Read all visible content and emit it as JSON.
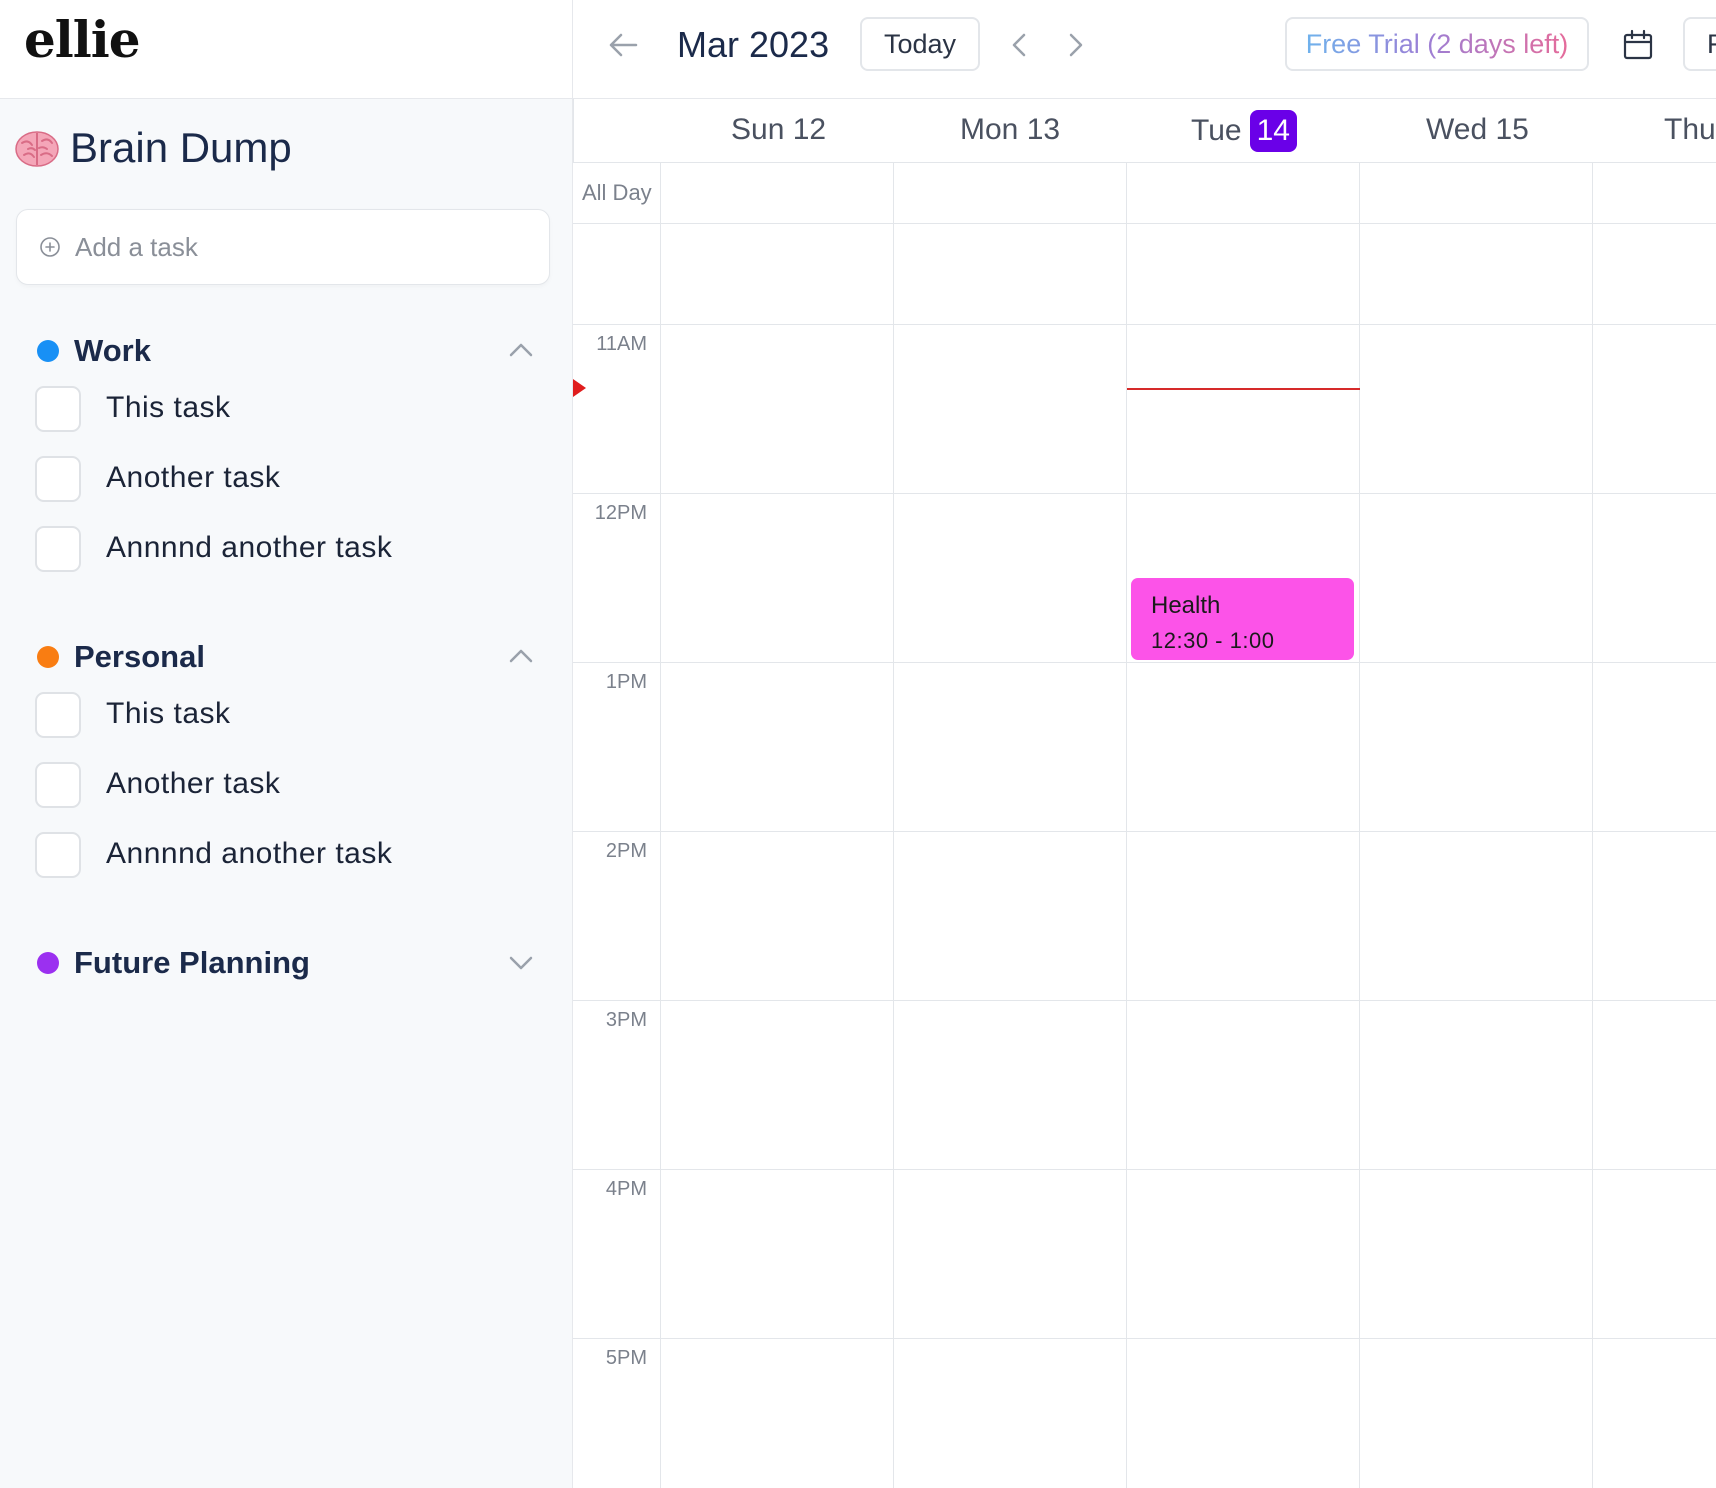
{
  "app": {
    "logo": "ellie"
  },
  "sidebar": {
    "title": "Brain Dump",
    "title_icon": "brain-icon",
    "add_task": {
      "placeholder": "Add a task",
      "icon": "plus-circle-icon"
    },
    "groups": [
      {
        "name": "Work",
        "color": "#1890f5",
        "expanded": true,
        "chevron": "chevron-up-icon",
        "tasks": [
          "This task",
          "Another task",
          "Annnnd another task"
        ]
      },
      {
        "name": "Personal",
        "color": "#f97d12",
        "expanded": true,
        "chevron": "chevron-up-icon",
        "tasks": [
          "This task",
          "Another task",
          "Annnnd another task"
        ]
      },
      {
        "name": "Future Planning",
        "color": "#9b30f0",
        "expanded": false,
        "chevron": "chevron-down-icon",
        "tasks": []
      }
    ]
  },
  "header": {
    "back_icon": "arrow-left-icon",
    "month": "Mar 2023",
    "today_label": "Today",
    "prev_icon": "chevron-left-icon",
    "next_icon": "chevron-right-icon",
    "trial_label": "Free Trial (2 days left)",
    "calendar_icon": "calendar-icon",
    "cut_button_label": "F"
  },
  "calendar": {
    "days": [
      {
        "name": "Sun",
        "date": "12",
        "today": false
      },
      {
        "name": "Mon",
        "date": "13",
        "today": false
      },
      {
        "name": "Tue",
        "date": "14",
        "today": true
      },
      {
        "name": "Wed",
        "date": "15",
        "today": false
      },
      {
        "name": "Thu",
        "date": "",
        "today": false
      }
    ],
    "all_day_label": "All Day",
    "time_labels": [
      "11AM",
      "12PM",
      "1PM",
      "2PM",
      "3PM",
      "4PM",
      "5PM"
    ],
    "today_accent": "#6a00e8",
    "now_indicator_color": "#d62a2a",
    "events": [
      {
        "title": "Health",
        "time": "12:30 - 1:00",
        "day": "Tue 14",
        "color": "#fc53e8"
      }
    ]
  }
}
